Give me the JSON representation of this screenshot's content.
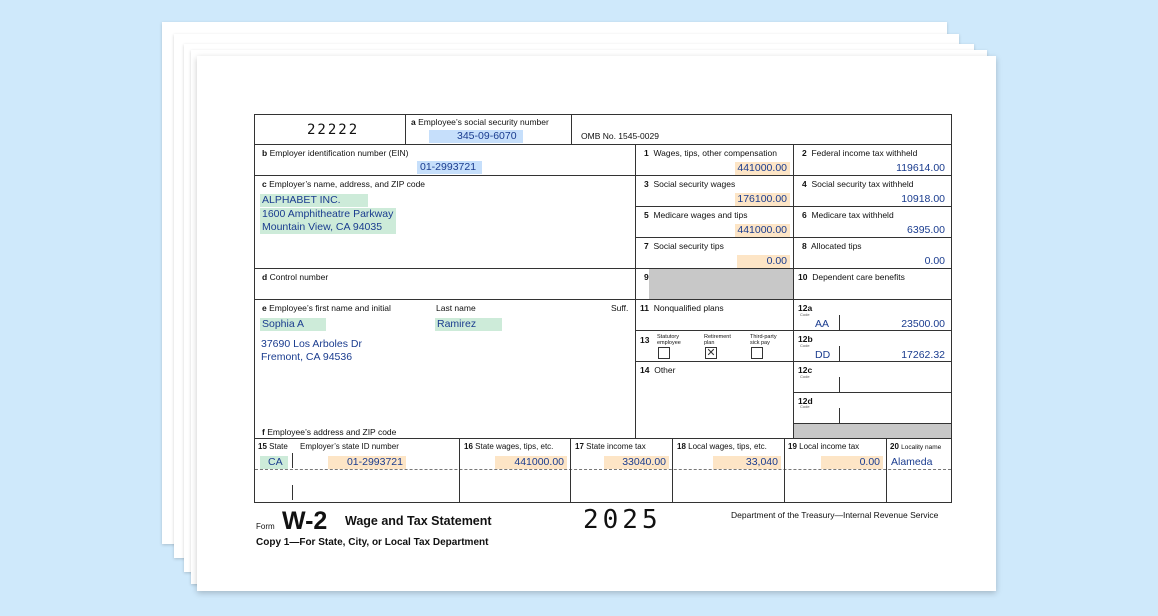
{
  "form": {
    "control_code": "22222",
    "omb": "OMB No. 1545-0029",
    "a_label": "Employee’s social security number",
    "a_letter": "a",
    "ssn": "345-09-6070",
    "b_label": "Employer identification number (EIN)",
    "b_letter": "b",
    "ein": "01-2993721",
    "c_label": "Employer’s name, address, and ZIP code",
    "c_letter": "c",
    "employer_name": "ALPHABET INC.",
    "employer_street": "1600 Amphitheatre Parkway",
    "employer_city": "Mountain View, CA 94035",
    "d_label": "Control number",
    "d_letter": "d",
    "e_label": "Employee’s first name and initial",
    "e_letter": "e",
    "last_name_label": "Last name",
    "suff_label": "Suff.",
    "first_name": "Sophia A",
    "last_name": "Ramirez",
    "employee_street": "37690 Los Arboles Dr",
    "employee_city": "Fremont, CA 94536",
    "f_label": "Employee’s address and ZIP code",
    "f_letter": "f",
    "box1_label": "Wages, tips, other compensation",
    "box1_num": "1",
    "box1": "441000.00",
    "box2_label": "Federal income tax withheld",
    "box2_num": "2",
    "box2": "119614.00",
    "box3_label": "Social security wages",
    "box3_num": "3",
    "box3": "176100.00",
    "box4_label": "Social security tax withheld",
    "box4_num": "4",
    "box4": "10918.00",
    "box5_label": "Medicare wages and tips",
    "box5_num": "5",
    "box5": "441000.00",
    "box6_label": "Medicare tax withheld",
    "box6_num": "6",
    "box6": "6395.00",
    "box7_label": "Social security tips",
    "box7_num": "7",
    "box7": "0.00",
    "box8_label": "Allocated tips",
    "box8_num": "8",
    "box8": "0.00",
    "box9_num": "9",
    "box10_label": "Dependent care benefits",
    "box10_num": "10",
    "box11_label": "Nonqualified plans",
    "box11_num": "11",
    "box13_num": "13",
    "box13_statutory": "Statutory employee",
    "box13_retirement": "Retirement plan",
    "box13_thirdparty": "Third-party sick pay",
    "box13_retirement_mark": "✕",
    "box14_label": "Other",
    "box14_num": "14",
    "box12a_label": "12a",
    "box12a_code": "AA",
    "box12a_amount": "23500.00",
    "box12b_label": "12b",
    "box12b_code": "DD",
    "box12b_amount": "17262.32",
    "box12c_label": "12c",
    "box12d_label": "12d",
    "code_vertical": "Code",
    "box15_num": "15",
    "box15_label": "State",
    "state_id_label": "Employer’s state ID number",
    "state": "CA",
    "state_id": "01-2993721",
    "box16_num": "16",
    "box16_label": "State wages, tips, etc.",
    "box16": "441000.00",
    "box17_num": "17",
    "box17_label": "State income tax",
    "box17": "33040.00",
    "box18_num": "18",
    "box18_label": "Local wages, tips, etc.",
    "box18": "33,040",
    "box19_num": "19",
    "box19_label": "Local income tax",
    "box19": "0.00",
    "box20_num": "20",
    "box20_label": "Locality name",
    "box20": "Alameda"
  },
  "footer": {
    "form_word": "Form",
    "form_name": "W-2",
    "title": "Wage and Tax Statement",
    "year": "2025",
    "department": "Department of the Treasury—Internal Revenue Service",
    "copy": "Copy 1—For State, City, or Local Tax Department"
  },
  "colors": {
    "background": "#cfe9fb",
    "filled_text": "#1a3c8f",
    "highlight_blue": "#c6dffb",
    "highlight_orange": "#fde5c6",
    "highlight_green": "#cdebd9"
  }
}
